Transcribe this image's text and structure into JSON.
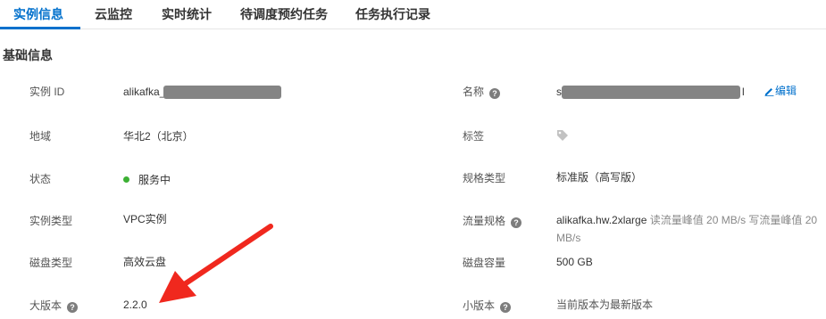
{
  "tabs": [
    {
      "label": "实例信息",
      "active": true
    },
    {
      "label": "云监控"
    },
    {
      "label": "实时统计"
    },
    {
      "label": "待调度预约任务"
    },
    {
      "label": "任务执行记录"
    }
  ],
  "section_title": "基础信息",
  "fields": {
    "instance_id": {
      "label": "实例 ID",
      "value": "alikafka_"
    },
    "name": {
      "label": "名称",
      "value_prefix": "s",
      "value_suffix": "l",
      "edit_label": "编辑"
    },
    "region": {
      "label": "地域",
      "value": "华北2（北京）"
    },
    "tags": {
      "label": "标签",
      "icon": "tag-icon"
    },
    "status": {
      "label": "状态",
      "value": "服务中",
      "status_color": "#3cb034"
    },
    "spec_type": {
      "label": "规格类型",
      "value": "标准版（高写版）"
    },
    "instance_type": {
      "label": "实例类型",
      "value": "VPC实例"
    },
    "traffic_spec": {
      "label": "流量规格",
      "value_main": "alikafka.hw.2xlarge",
      "value_detail": " 读流量峰值 20 MB/s 写流量峰值 20 MB/s"
    },
    "disk_type": {
      "label": "磁盘类型",
      "value": "高效云盘"
    },
    "disk_capacity": {
      "label": "磁盘容量",
      "value": "500 GB"
    },
    "major_version": {
      "label": "大版本",
      "value": "2.2.0"
    },
    "minor_version": {
      "label": "小版本",
      "value": "当前版本为最新版本"
    }
  },
  "help_glyph": "?",
  "colors": {
    "accent": "#0070cc",
    "annotation_arrow": "#f0281e",
    "redaction": "#848484"
  }
}
